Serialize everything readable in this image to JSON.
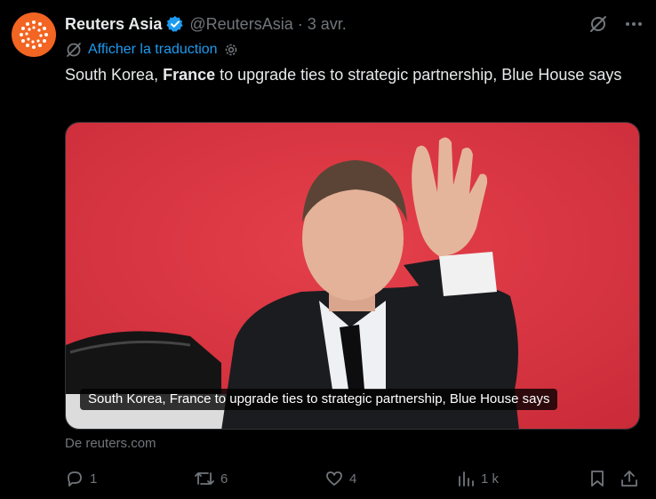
{
  "tweet": {
    "author_name": "Reuters Asia",
    "handle": "@ReutersAsia",
    "separator": "·",
    "date": "3 avr.",
    "translate_label": "Afficher la traduction",
    "text_before": "South Korea, ",
    "text_bold": "France",
    "text_after": " to upgrade ties to strategic partnership, Blue House says"
  },
  "card": {
    "caption": "South Korea, France to upgrade ties to strategic partnership, Blue House says",
    "source": "De reuters.com"
  },
  "actions": {
    "replies": "1",
    "reposts": "6",
    "likes": "4",
    "views": "1 k"
  },
  "colors": {
    "accent": "#1d9bf0",
    "brand": "#f26522",
    "muted": "#71767b",
    "background": "#000000"
  },
  "icons": [
    "reuters-logo-icon",
    "verified-badge-icon",
    "grok-icon",
    "more-icon",
    "translate-icon",
    "settings-icon",
    "reply-icon",
    "repost-icon",
    "like-icon",
    "views-icon",
    "bookmark-icon",
    "share-icon"
  ]
}
